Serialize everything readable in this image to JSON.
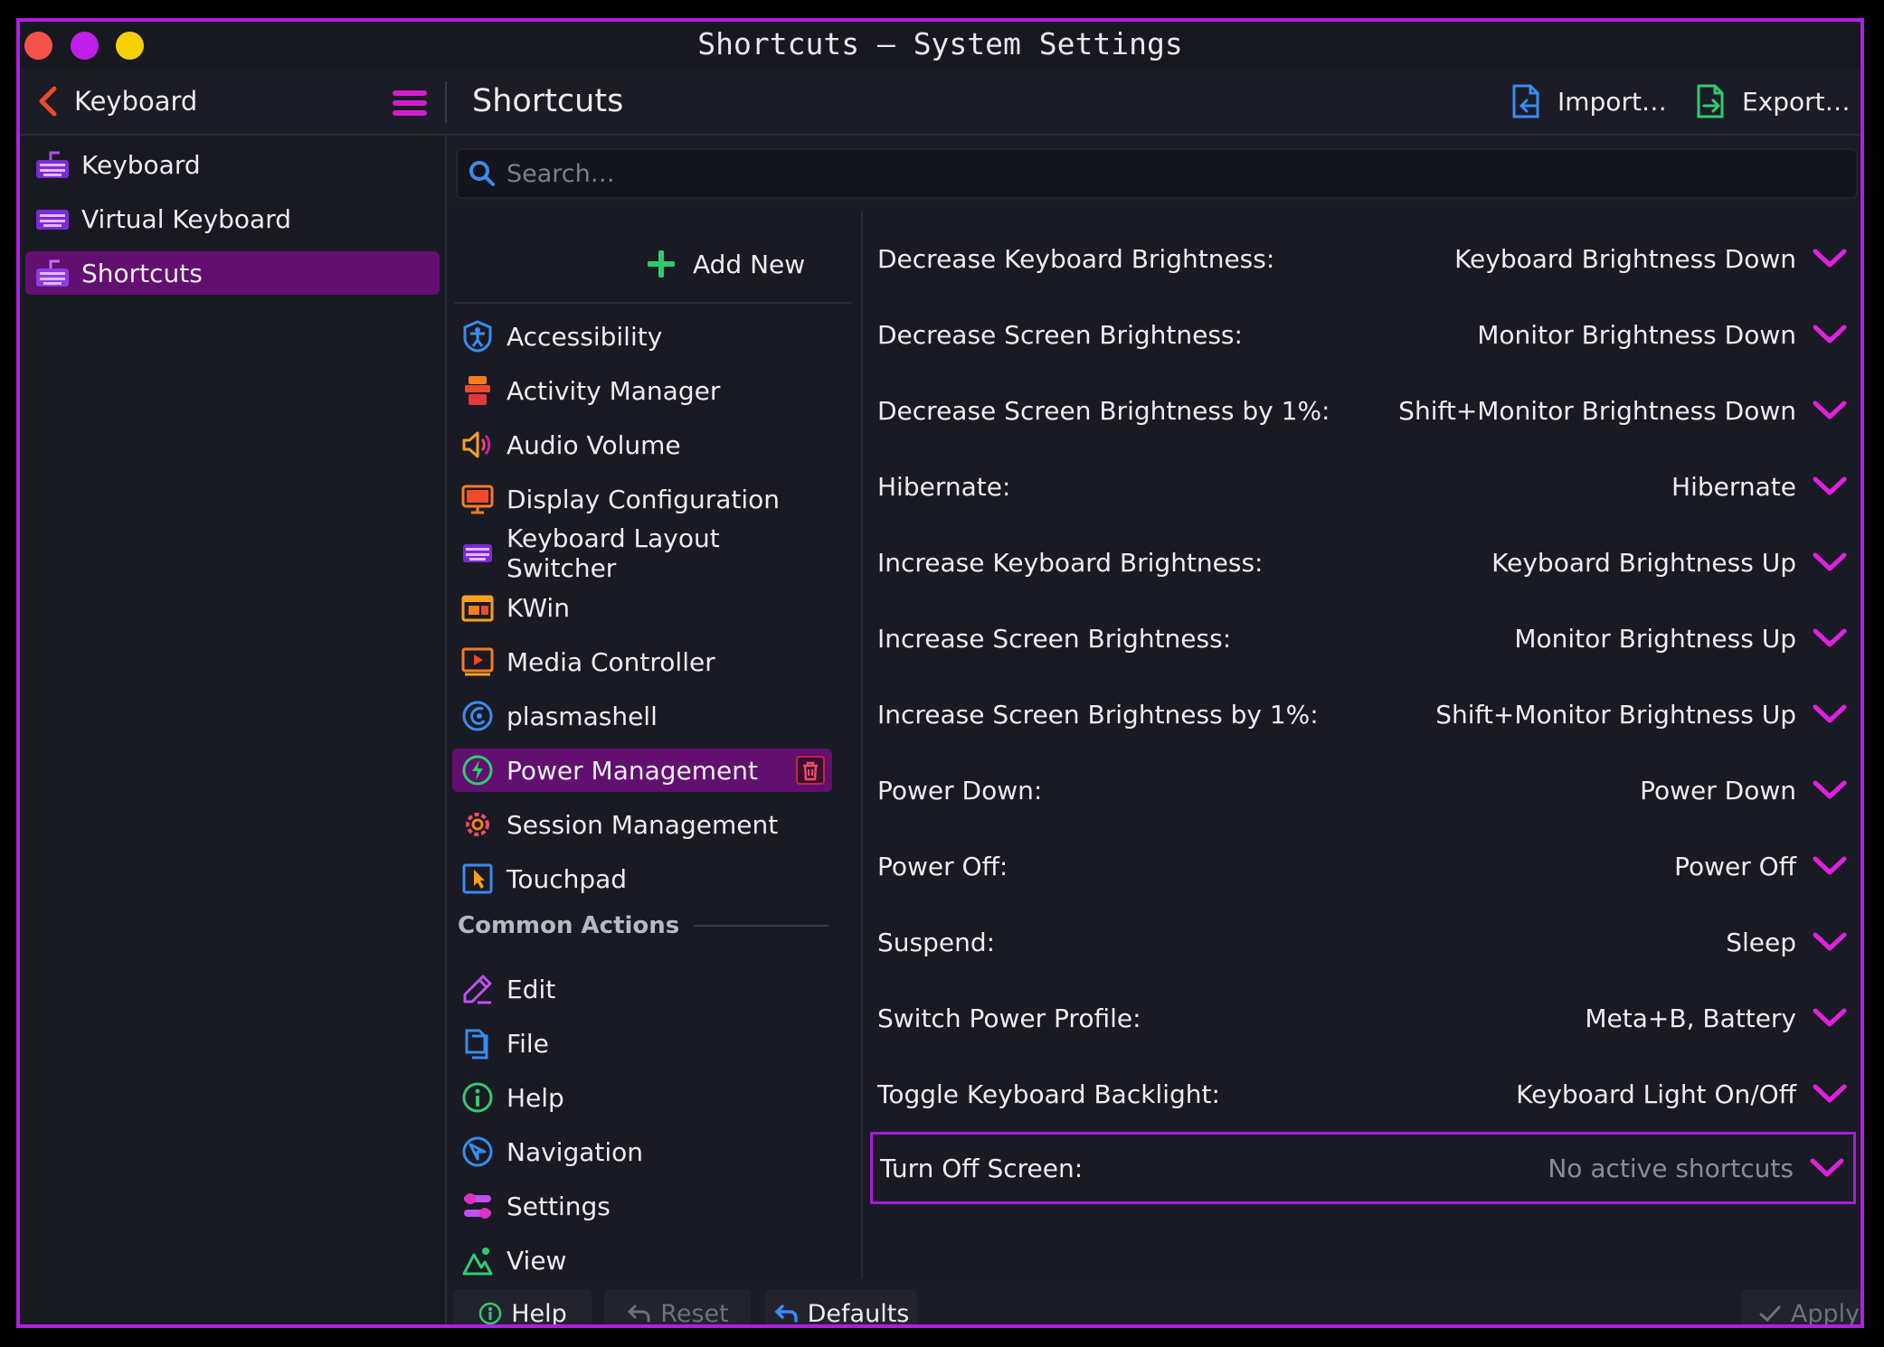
{
  "window": {
    "title": "Shortcuts — System Settings"
  },
  "header": {
    "left_title": "Keyboard",
    "page_title": "Shortcuts",
    "import_label": "Import…",
    "export_label": "Export…"
  },
  "sidebar": {
    "items": [
      {
        "label": "Keyboard",
        "icon": "keyboard-icon"
      },
      {
        "label": "Virtual Keyboard",
        "icon": "virtual-keyboard-icon"
      },
      {
        "label": "Shortcuts",
        "icon": "keyboard-icon",
        "active": true
      }
    ]
  },
  "search": {
    "placeholder": "Search…",
    "value": ""
  },
  "categories": {
    "add_new_label": "Add New",
    "items": [
      {
        "label": "Accessibility",
        "icon": "accessibility-icon"
      },
      {
        "label": "Activity Manager",
        "icon": "activity-manager-icon"
      },
      {
        "label": "Audio Volume",
        "icon": "audio-volume-icon"
      },
      {
        "label": "Display Configuration",
        "icon": "display-icon"
      },
      {
        "label": "Keyboard Layout Switcher",
        "icon": "keyboard-icon"
      },
      {
        "label": "KWin",
        "icon": "kwin-icon"
      },
      {
        "label": "Media Controller",
        "icon": "media-controller-icon"
      },
      {
        "label": "plasmashell",
        "icon": "plasmashell-icon"
      },
      {
        "label": "Power Management",
        "icon": "power-management-icon",
        "active": true
      },
      {
        "label": "Session Management",
        "icon": "session-management-icon"
      },
      {
        "label": "Touchpad",
        "icon": "touchpad-icon"
      }
    ],
    "common_actions_header": "Common Actions",
    "common_actions": [
      {
        "label": "Edit",
        "icon": "edit-icon"
      },
      {
        "label": "File",
        "icon": "file-icon"
      },
      {
        "label": "Help",
        "icon": "help-icon"
      },
      {
        "label": "Navigation",
        "icon": "navigation-icon"
      },
      {
        "label": "Settings",
        "icon": "settings-icon"
      },
      {
        "label": "View",
        "icon": "view-icon"
      }
    ]
  },
  "shortcuts": [
    {
      "action": "Decrease Keyboard Brightness:",
      "value": "Keyboard Brightness Down"
    },
    {
      "action": "Decrease Screen Brightness:",
      "value": "Monitor Brightness Down"
    },
    {
      "action": "Decrease Screen Brightness by 1%:",
      "value": "Shift+Monitor Brightness Down"
    },
    {
      "action": "Hibernate:",
      "value": "Hibernate"
    },
    {
      "action": "Increase Keyboard Brightness:",
      "value": "Keyboard Brightness Up"
    },
    {
      "action": "Increase Screen Brightness:",
      "value": "Monitor Brightness Up"
    },
    {
      "action": "Increase Screen Brightness by 1%:",
      "value": "Shift+Monitor Brightness Up"
    },
    {
      "action": "Power Down:",
      "value": "Power Down"
    },
    {
      "action": "Power Off:",
      "value": "Power Off"
    },
    {
      "action": "Suspend:",
      "value": "Sleep"
    },
    {
      "action": "Switch Power Profile:",
      "value": "Meta+B, Battery"
    },
    {
      "action": "Toggle Keyboard Backlight:",
      "value": "Keyboard Light On/Off"
    },
    {
      "action": "Turn Off Screen:",
      "value": "No active shortcuts",
      "selected": true,
      "inactive": true
    }
  ],
  "footer": {
    "help_label": "Help",
    "reset_label": "Reset",
    "defaults_label": "Defaults",
    "apply_label": "Apply"
  },
  "colors": {
    "accent": "#B01FE0",
    "selection": "#62106F",
    "chevron": "#E020E0",
    "background": "#1B1B25"
  }
}
